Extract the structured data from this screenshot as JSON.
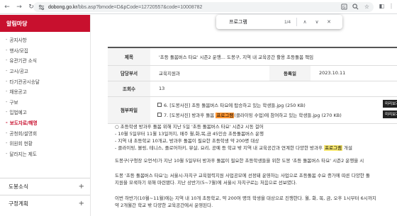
{
  "browser": {
    "url_host": "dobong.go.kr",
    "url_path": "/bbs.asp?bmode=D&pCode=12720557&code=10008782"
  },
  "find": {
    "query": "프로그램",
    "count": "1/4"
  },
  "sidebar": {
    "header": "알림마당",
    "items": [
      {
        "label": "공지사항",
        "active": false
      },
      {
        "label": "행사/모집",
        "active": false
      },
      {
        "label": "유관기관 소식",
        "active": false
      },
      {
        "label": "고시/공고",
        "active": false
      },
      {
        "label": "타기관공시송달",
        "active": false
      },
      {
        "label": "채용공고",
        "active": false
      },
      {
        "label": "구보",
        "active": false
      },
      {
        "label": "입법예고",
        "active": false
      },
      {
        "label": "보도자료/해명",
        "active": true
      },
      {
        "label": "공청회/설명회",
        "active": false
      },
      {
        "label": "위원회 현황",
        "active": false
      },
      {
        "label": "달라지는 제도",
        "active": false
      }
    ],
    "groups": [
      {
        "label": "도봉소식"
      },
      {
        "label": "구정계획"
      }
    ]
  },
  "post": {
    "title_label": "제목",
    "title": "'초등 돌봄버스 타요' 시즌2 운행... 도봉구, 지역 내 교육공간 활용 초등돌봄 책임",
    "dept_label": "담당부서",
    "dept": "교육지원과",
    "date_label": "등록일",
    "date": "2023.10.11",
    "views_label": "조회수",
    "views": "13",
    "files_label": "첨부파일",
    "file1": "6. [도봉사진] 초등 돌봄버스 타요에 탑승하고 있는 학생들.jpg (250 KB)",
    "file2_pre": "7. [도봉사진] 방과후 돌봄 ",
    "file2_hl": "프로그램",
    "file2_post": "(클라이밍 수업)에 참여하고 있는 학생들.jpg (270 KB)",
    "preview_label": "미리보기"
  },
  "body": {
    "line1": "○ 초등학생 방과후 돌봄 위해 지난 5일 '초등 돌봄버스 타요' 시즌2 시동 걸어",
    "line2": "- 10월 5일부터 11월 13일까지, 매주 월,화,목,금 45인승 초등돌봄버스 운행",
    "line3": "- 지역 내 초등학교 10개교, 방과후 돌봄이 필요한 초등학생 약 200명 대상",
    "line4_pre": "- 클라이밍, 볼링, 테니스, 플로어하키, 뮤살, 요리, 공예 등 학교 밖 지역 내 교육공간과 연계한 다양한 방과후 ",
    "line4_hl": "프로그램",
    "line4_post": " 개설",
    "para1": "도봉구(구청장 오언석)가 지난 10월 5일부터 방과후 돌봄이 필요한 초등학생들을 위한 도봉 '초등 돌봄버스 타요' 시즌2 운행을 시",
    "para2a": "도봉 '초등 돌봄버스 타요'는 서울시-자치구 교육협력지원 사업공모에 선정돼 운영하는 사업으로 초등돌봄 수요 증가에 따른 다양한 돌",
    "para2b": "지원을 모색하기 위해 마련됐다. 지난 상반기(5~7월)에 서울시 자치구로는 처음으로 선보였다.",
    "para3a": "이번 하반기(10월~11월)에는 지역 내 10개 초등학교, 약 200여 명의 학생을 대상으로 진행한다. 월, 화, 목, 금, 오후 1시부터 6시까지",
    "para3b": "약 2개월간 학교 밖 다양한 교육공간에서 운영된다."
  },
  "colors": {
    "brand": "#c8102e",
    "find_highlight": "#ff9632",
    "match_highlight": "#f6e66e"
  }
}
